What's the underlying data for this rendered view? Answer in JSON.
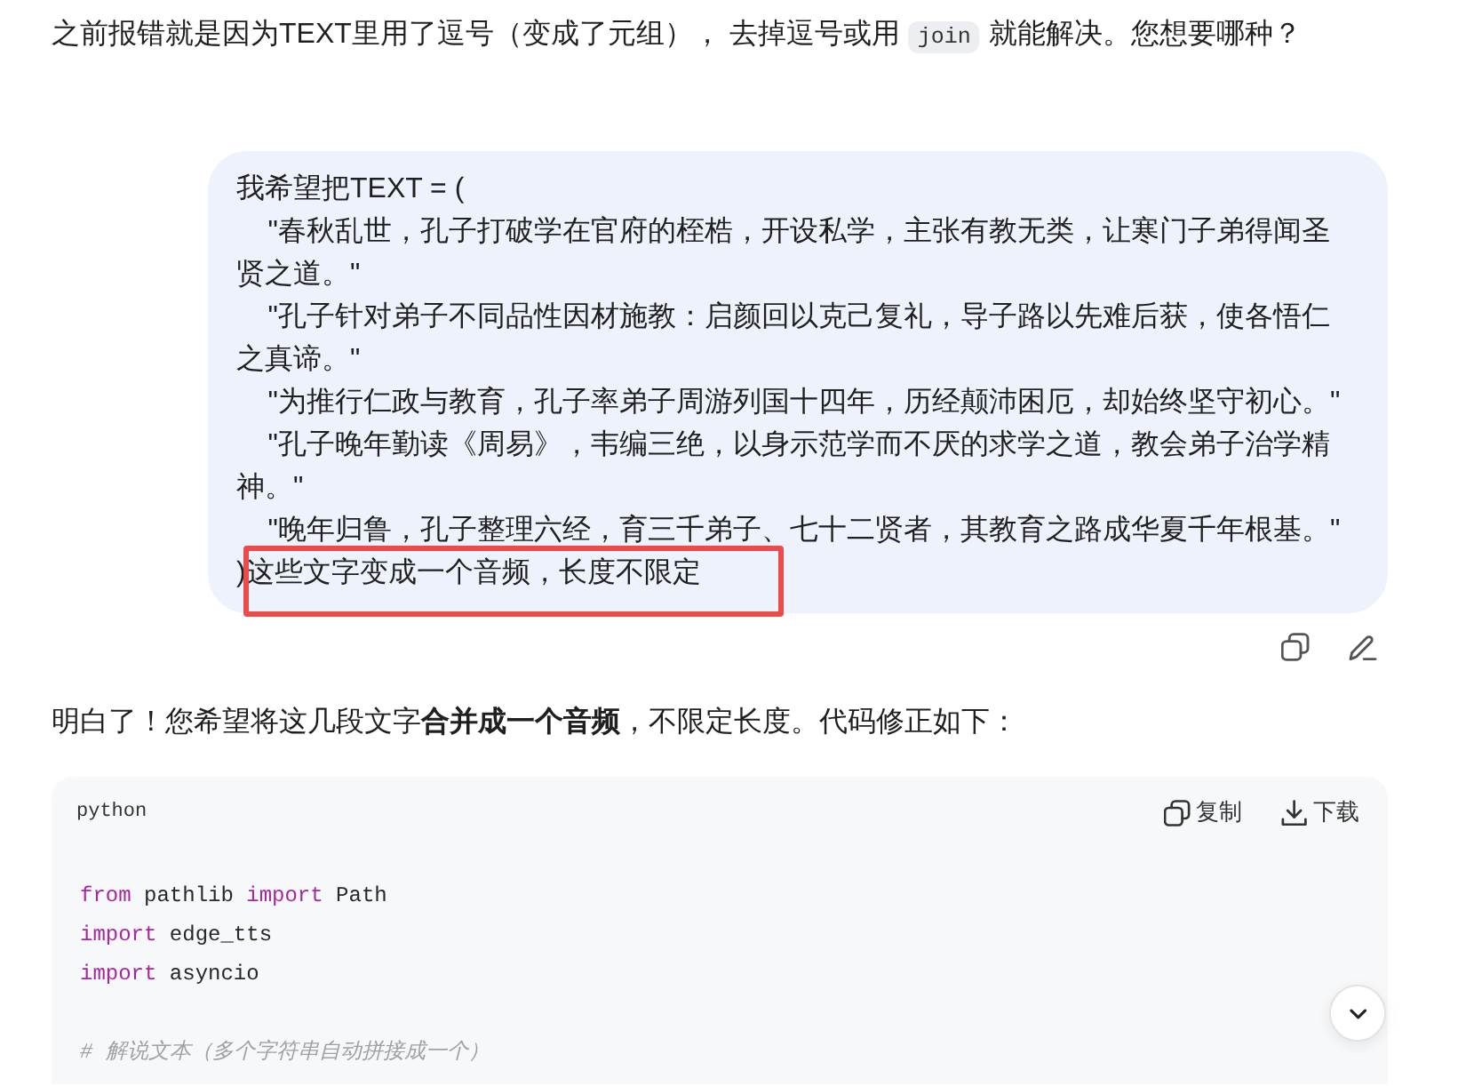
{
  "intro": {
    "parts": [
      {
        "kind": "text",
        "text": "之前报错就是因为TEXT里用了逗号（变成了元组）， 去掉逗号或用"
      },
      {
        "kind": "code",
        "text": "join"
      },
      {
        "kind": "text",
        "text": "就能解决。您想要哪种？"
      }
    ]
  },
  "user_message": {
    "lines": [
      {
        "text": "我希望把TEXT = (",
        "highlighted": false
      },
      {
        "text": "    \"春秋乱世，孔子打破学在官府的桎梏，开设私学，主张有教无类，让寒门子弟得闻圣",
        "highlighted": false
      },
      {
        "text": "贤之道。\"",
        "highlighted": false
      },
      {
        "text": "    \"孔子针对弟子不同品性因材施教：启颜回以克己复礼，导子路以先难后获，使各悟仁",
        "highlighted": false
      },
      {
        "text": "之真谛。\"",
        "highlighted": false
      },
      {
        "text": "    \"为推行仁政与教育，孔子率弟子周游列国十四年，历经颠沛困厄，却始终坚守初心。\"",
        "highlighted": false
      },
      {
        "text": "    \"孔子晚年勤读《周易》，韦编三绝，以身示范学而不厌的求学之道，教会弟子治学精",
        "highlighted": false
      },
      {
        "text": "神。\"",
        "highlighted": false
      },
      {
        "text": "    \"晚年归鲁，孔子整理六经，育三千弟子、七十二贤者，其教育之路成华夏千年根基。\"",
        "highlighted": false
      },
      {
        "text": ")这些文字变成一个音频，长度不限定",
        "highlighted": true
      }
    ]
  },
  "message_actions": [
    {
      "kind": "copy"
    },
    {
      "kind": "edit"
    }
  ],
  "reply": {
    "text": "明白了！您希望将这几段文字**合并成一个音频**，不限定长度。代码修正如下："
  },
  "code_block": {
    "language": "python",
    "actions": [
      {
        "kind": "copy",
        "label": "复制"
      },
      {
        "kind": "download",
        "label": "下载"
      }
    ],
    "groups": [
      {
        "lines": [
          {
            "tokens": [
              {
                "kind": "keyword",
                "text": "from"
              },
              {
                "kind": "plain",
                "text": " pathlib "
              },
              {
                "kind": "keyword",
                "text": "import"
              },
              {
                "kind": "plain",
                "text": " Path"
              }
            ]
          },
          {
            "tokens": [
              {
                "kind": "keyword",
                "text": "import"
              },
              {
                "kind": "plain",
                "text": " edge_tts"
              }
            ]
          },
          {
            "tokens": [
              {
                "kind": "keyword",
                "text": "import"
              },
              {
                "kind": "plain",
                "text": " asyncio"
              }
            ]
          }
        ]
      },
      {
        "lines": [
          {
            "tokens": [
              {
                "kind": "comment",
                "text": "# 解说文本（多个字符串自动拼接成一个）"
              }
            ]
          }
        ]
      }
    ]
  }
}
